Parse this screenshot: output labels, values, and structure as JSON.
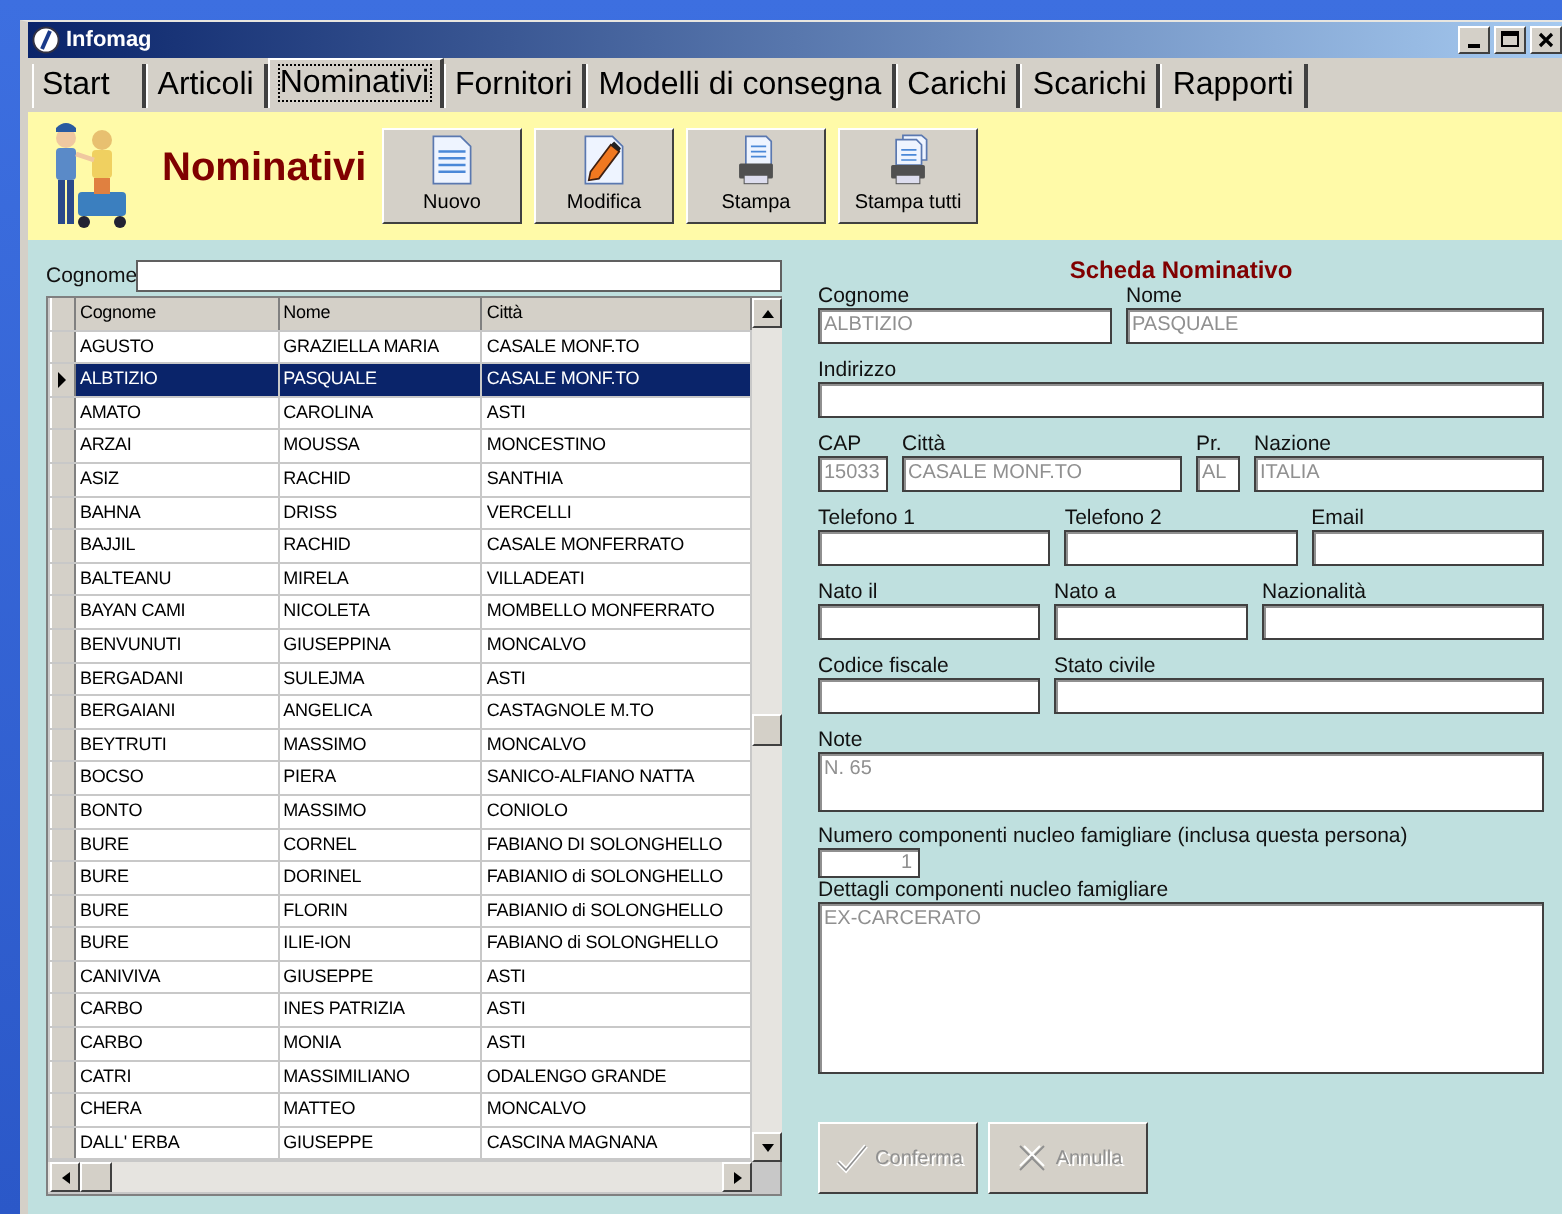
{
  "window": {
    "title": "Infomag"
  },
  "tabs": [
    {
      "label": "Start",
      "selected": false
    },
    {
      "label": "Articoli",
      "selected": false
    },
    {
      "label": "Nominativi",
      "selected": true
    },
    {
      "label": "Fornitori",
      "selected": false
    },
    {
      "label": "Modelli di consegna",
      "selected": false
    },
    {
      "label": "Carichi",
      "selected": false
    },
    {
      "label": "Scarichi",
      "selected": false
    },
    {
      "label": "Rapporti",
      "selected": false
    }
  ],
  "toolbar": {
    "title": "Nominativi",
    "buttons": [
      {
        "label": "Nuovo",
        "kind": "new"
      },
      {
        "label": "Modifica",
        "kind": "edit"
      },
      {
        "label": "Stampa",
        "kind": "print"
      },
      {
        "label": "Stampa tutti",
        "kind": "print_all"
      }
    ]
  },
  "search": {
    "label": "Cognome"
  },
  "table": {
    "columns": [
      "Cognome",
      "Nome",
      "Città"
    ],
    "rows": [
      {
        "cells": [
          "AGUSTO",
          "GRAZIELLA MARIA",
          "CASALE MONF.TO"
        ],
        "selected": false
      },
      {
        "cells": [
          "ALBTIZIO",
          "PASQUALE",
          "CASALE MONF.TO"
        ],
        "selected": true
      },
      {
        "cells": [
          "AMATO",
          "CAROLINA",
          "ASTI"
        ],
        "selected": false
      },
      {
        "cells": [
          "ARZAI",
          "MOUSSA",
          "MONCESTINO"
        ],
        "selected": false
      },
      {
        "cells": [
          "ASIZ",
          "RACHID",
          "SANTHIA"
        ],
        "selected": false
      },
      {
        "cells": [
          "BAHNA",
          "DRISS",
          "VERCELLI"
        ],
        "selected": false
      },
      {
        "cells": [
          "BAJJIL",
          "RACHID",
          "CASALE MONFERRATO"
        ],
        "selected": false
      },
      {
        "cells": [
          "BALTEANU",
          "MIRELA",
          "VILLADEATI"
        ],
        "selected": false
      },
      {
        "cells": [
          "BAYAN CAMI",
          "NICOLETA",
          "MOMBELLO MONFERRATO"
        ],
        "selected": false
      },
      {
        "cells": [
          "BENVUNUTI",
          "GIUSEPPINA",
          "MONCALVO"
        ],
        "selected": false
      },
      {
        "cells": [
          "BERGADANI",
          "SULEJMA",
          "ASTI"
        ],
        "selected": false
      },
      {
        "cells": [
          "BERGAIANI",
          "ANGELICA",
          "CASTAGNOLE M.TO"
        ],
        "selected": false
      },
      {
        "cells": [
          "BEYTRUTI",
          "MASSIMO",
          "MONCALVO"
        ],
        "selected": false
      },
      {
        "cells": [
          "BOCSO",
          "PIERA",
          "SANICO-ALFIANO NATTA"
        ],
        "selected": false
      },
      {
        "cells": [
          "BONTO",
          "MASSIMO",
          "CONIOLO"
        ],
        "selected": false
      },
      {
        "cells": [
          "BURE",
          "CORNEL",
          "FABIANO DI SOLONGHELLO"
        ],
        "selected": false
      },
      {
        "cells": [
          "BURE",
          "DORINEL",
          "FABIANIO di SOLONGHELLO"
        ],
        "selected": false
      },
      {
        "cells": [
          "BURE",
          "FLORIN",
          "FABIANIO di SOLONGHELLO"
        ],
        "selected": false
      },
      {
        "cells": [
          "BURE",
          "ILIE-ION",
          "FABIANO di SOLONGHELLO"
        ],
        "selected": false
      },
      {
        "cells": [
          "CANIVIVA",
          "GIUSEPPE",
          "ASTI"
        ],
        "selected": false
      },
      {
        "cells": [
          "CARBO",
          "INES PATRIZIA",
          "ASTI"
        ],
        "selected": false
      },
      {
        "cells": [
          "CARBO",
          "MONIA",
          "ASTI"
        ],
        "selected": false
      },
      {
        "cells": [
          "CATRI",
          "MASSIMILIANO",
          "ODALENGO GRANDE"
        ],
        "selected": false
      },
      {
        "cells": [
          "CHERA",
          "MATTEO",
          "MONCALVO"
        ],
        "selected": false
      },
      {
        "cells": [
          "DALL' ERBA",
          "GIUSEPPE",
          "CASCINA MAGNANA"
        ],
        "selected": false
      }
    ]
  },
  "form": {
    "title": "Scheda Nominativo",
    "rows": [
      [
        {
          "label": "Cognome",
          "value": "ALBTIZIO"
        },
        {
          "label": "Nome",
          "value": "PASQUALE"
        }
      ],
      [
        {
          "label": "Indirizzo"
        }
      ],
      [
        {
          "label": "CAP",
          "value": "15033"
        },
        {
          "label": "Città",
          "value": "CASALE MONF.TO"
        },
        {
          "label": "Pr.",
          "value": "AL"
        },
        {
          "label": "Nazione",
          "value": "ITALIA"
        }
      ],
      [
        {
          "label": "Telefono 1"
        },
        {
          "label": "Telefono 2"
        },
        {
          "label": "Email"
        }
      ],
      [
        {
          "label": "Nato il"
        },
        {
          "label": "Nato a"
        },
        {
          "label": "Nazionalità"
        }
      ],
      [
        {
          "label": "Codice fiscale"
        },
        {
          "label": "Stato civile"
        }
      ]
    ],
    "note": {
      "label": "Note",
      "value": "N. 65"
    },
    "members": {
      "label": "Numero componenti nucleo famigliare (inclusa questa persona)",
      "value": "1"
    },
    "details": {
      "label": "Dettagli componenti nucleo famigliare",
      "value": "EX-CARCERATO"
    }
  },
  "buttons": [
    {
      "label": "Conferma",
      "kind": "confirm",
      "disabled": true
    },
    {
      "label": "Annulla",
      "kind": "cancel",
      "disabled": true
    }
  ]
}
